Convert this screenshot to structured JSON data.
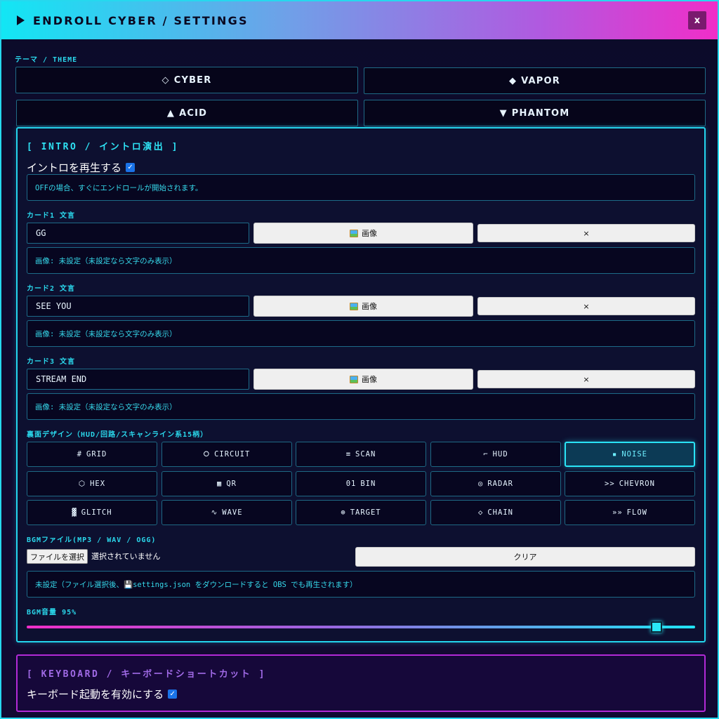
{
  "window": {
    "title": "ENDROLL CYBER / SETTINGS",
    "close_label": "x"
  },
  "theme": {
    "label": "テーマ / THEME",
    "options": [
      {
        "icon": "◇",
        "label": "CYBER",
        "active": true
      },
      {
        "icon": "◆",
        "label": "VAPOR",
        "active": false
      },
      {
        "icon": "▲",
        "label": "ACID",
        "active": false
      },
      {
        "icon": "▼",
        "label": "PHANTOM",
        "active": false
      }
    ]
  },
  "intro": {
    "heading": "[ INTRO / イントロ演出 ]",
    "play_label": "イントロを再生する",
    "play_checked": true,
    "note": "OFFの場合、すぐにエンドロールが開始されます。",
    "image_button": "画像",
    "clear_button": "×",
    "cards": [
      {
        "label": "カード1 文言",
        "value": "GG",
        "image_note": "画像: 未設定（未設定なら文字のみ表示）"
      },
      {
        "label": "カード2 文言",
        "value": "SEE YOU",
        "image_note": "画像: 未設定（未設定なら文字のみ表示）"
      },
      {
        "label": "カード3 文言",
        "value": "STREAM END",
        "image_note": "画像: 未設定（未設定なら文字のみ表示）"
      }
    ]
  },
  "design": {
    "label": "裏面デザイン（HUD/回路/スキャンライン系15柄）",
    "options": [
      {
        "icon": "#",
        "label": "GRID",
        "active": false
      },
      {
        "icon": "⭘",
        "label": "CIRCUIT",
        "active": false
      },
      {
        "icon": "≡",
        "label": "SCAN",
        "active": false
      },
      {
        "icon": "⌐",
        "label": "HUD",
        "active": false
      },
      {
        "icon": "▪",
        "label": "NOISE",
        "active": true
      },
      {
        "icon": "⬡",
        "label": "HEX",
        "active": false
      },
      {
        "icon": "▦",
        "label": "QR",
        "active": false
      },
      {
        "icon": "01",
        "label": "BIN",
        "active": false
      },
      {
        "icon": "◎",
        "label": "RADAR",
        "active": false
      },
      {
        "icon": ">>",
        "label": "CHEVRON",
        "active": false
      },
      {
        "icon": "▓",
        "label": "GLITCH",
        "active": false
      },
      {
        "icon": "∿",
        "label": "WAVE",
        "active": false
      },
      {
        "icon": "⊕",
        "label": "TARGET",
        "active": false
      },
      {
        "icon": "◇",
        "label": "CHAIN",
        "active": false
      },
      {
        "icon": "»»",
        "label": "FLOW",
        "active": false
      }
    ]
  },
  "bgm": {
    "label": "BGMファイル(MP3 / WAV / OGG)",
    "choose_button": "ファイルを選択",
    "file_status": "選択されていません",
    "clear_button": "クリア",
    "note": "未設定（ファイル選択後、💾settings.json をダウンロードすると OBS でも再生されます）",
    "volume_label": "BGM音量 95%",
    "volume": 0.95
  },
  "keyboard": {
    "heading": "[ KEYBOARD / キーボードショートカット ]",
    "enable_label": "キーボード起動を有効にする",
    "enable_checked": true
  }
}
